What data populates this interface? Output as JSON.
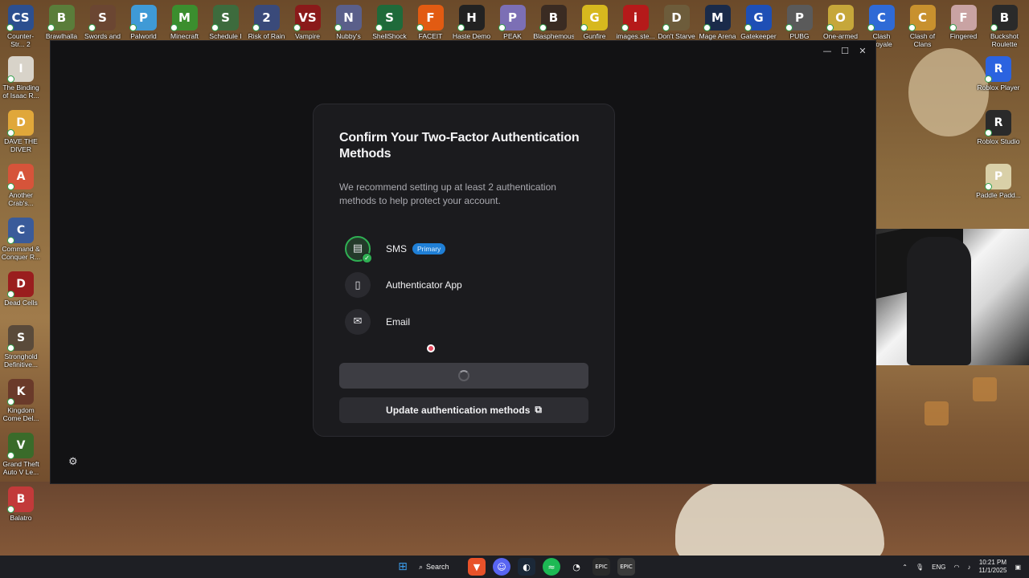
{
  "desktop": {
    "top_icons": [
      {
        "label": "Counter-Str... 2",
        "color": "#2c4f8f",
        "glyph": "CS"
      },
      {
        "label": "Brawlhalla",
        "color": "#5a7d3a",
        "glyph": "B"
      },
      {
        "label": "Swords and",
        "color": "#6b4632",
        "glyph": "S"
      },
      {
        "label": "Palworld",
        "color": "#3f9ad6",
        "glyph": "P"
      },
      {
        "label": "Minecraft",
        "color": "#3b8e2e",
        "glyph": "M"
      },
      {
        "label": "Schedule I",
        "color": "#3d6b3d",
        "glyph": "S"
      },
      {
        "label": "Risk of Rain 2",
        "color": "#3a4a7a",
        "glyph": "2"
      },
      {
        "label": "Vampire",
        "color": "#8a1a1a",
        "glyph": "VS"
      },
      {
        "label": "Nubby's",
        "color": "#5a5f8a",
        "glyph": "N"
      },
      {
        "label": "ShellShock",
        "color": "#1f6a3a",
        "glyph": "S"
      },
      {
        "label": "FACEIT",
        "color": "#e25b12",
        "glyph": "F"
      },
      {
        "label": "Haste Demo",
        "color": "#222222",
        "glyph": "H"
      },
      {
        "label": "PEAK",
        "color": "#7c6fb5",
        "glyph": "P"
      },
      {
        "label": "Blasphemous",
        "color": "#3a2b22",
        "glyph": "B"
      },
      {
        "label": "Gunfire",
        "color": "#d7b81e",
        "glyph": "G"
      },
      {
        "label": "images.ste...",
        "color": "#b51a1a",
        "glyph": "i"
      },
      {
        "label": "Don't Starve",
        "color": "#6d5c3b",
        "glyph": "D"
      },
      {
        "label": "Mage Arena",
        "color": "#1a2b4a",
        "glyph": "M"
      },
      {
        "label": "Gatekeeper",
        "color": "#1e4fb5",
        "glyph": "G"
      },
      {
        "label": "PUBG",
        "color": "#5a5a5a",
        "glyph": "P"
      },
      {
        "label": "One-armed",
        "color": "#c6a73a",
        "glyph": "O"
      },
      {
        "label": "Clash Royale",
        "color": "#2f6ad6",
        "glyph": "C"
      },
      {
        "label": "Clash of Clans",
        "color": "#c8912e",
        "glyph": "C"
      },
      {
        "label": "Fingered",
        "color": "#c9a3a3",
        "glyph": "F"
      },
      {
        "label": "Buckshot Roulette",
        "color": "#2a2a2a",
        "glyph": "B"
      }
    ],
    "left_icons": [
      {
        "label": "The Binding of Isaac R...",
        "color": "#d8d3c9",
        "glyph": "I"
      },
      {
        "label": "DAVE THE DIVER",
        "color": "#e0a73a",
        "glyph": "D"
      },
      {
        "label": "Another Crab's...",
        "color": "#d6543a",
        "glyph": "A"
      },
      {
        "label": "Command & Conquer R...",
        "color": "#3a5b9a",
        "glyph": "C"
      },
      {
        "label": "Dead Cells",
        "color": "#9a1e1e",
        "glyph": "D"
      },
      {
        "label": "Stronghold Definitive...",
        "color": "#5a4a3a",
        "glyph": "S"
      },
      {
        "label": "Kingdom Come Del...",
        "color": "#6a3a2a",
        "glyph": "K"
      },
      {
        "label": "Grand Theft Auto V Le...",
        "color": "#3a6b2a",
        "glyph": "V"
      },
      {
        "label": "Balatro",
        "color": "#c23a3a",
        "glyph": "B"
      }
    ],
    "right_icons": [
      {
        "label": "Roblox Player",
        "color": "#2b63e0",
        "glyph": "R"
      },
      {
        "label": "Roblox Studio",
        "color": "#2a2a2a",
        "glyph": "R"
      },
      {
        "label": "Paddle Padd...",
        "color": "#d9d0a8",
        "glyph": "P"
      }
    ]
  },
  "window": {
    "controls": {
      "minimize": "—",
      "maximize": "☐",
      "close": "✕"
    },
    "settings_icon": "⚙"
  },
  "card": {
    "title": "Confirm Your Two-Factor Authentication Methods",
    "description": "We recommend setting up at least 2 authentication methods to help protect your account.",
    "methods": [
      {
        "name": "SMS",
        "icon": "message-icon",
        "glyph": "▤",
        "badge": "Primary",
        "active": true
      },
      {
        "name": "Authenticator App",
        "icon": "phone-icon",
        "glyph": "▯",
        "badge": "",
        "active": false
      },
      {
        "name": "Email",
        "icon": "mail-icon",
        "glyph": "✉",
        "badge": "",
        "active": false
      }
    ],
    "update_button": "Update authentication methods",
    "external_glyph": "⧉"
  },
  "taskbar": {
    "search_label": "Search",
    "language": "ENG",
    "time": "10:21 PM",
    "date": "11/1/2025"
  },
  "colors": {
    "accent_green": "#2fb053",
    "badge_blue": "#1f7fd6"
  }
}
